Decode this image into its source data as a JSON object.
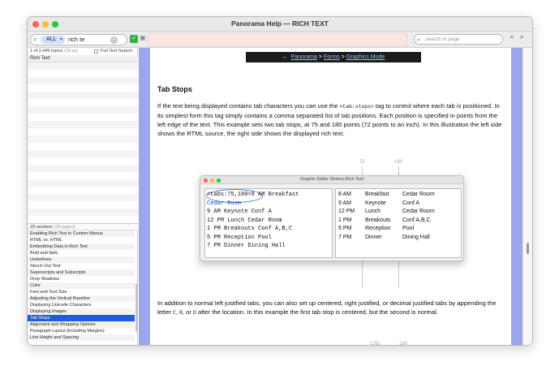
{
  "window": {
    "title": "Panorama Help — RICH TEXT"
  },
  "toolbar": {
    "search_scope": "ALL",
    "search_query": "rich te",
    "page_search_placeholder": "search in page",
    "prev": "<",
    "next": ">"
  },
  "sidebar": {
    "topics_count": "1 of 2,445 topics",
    "topics_pages": "(28 pp)",
    "full_text_label": "Full Text Search",
    "selected_topic": "Rich Text",
    "sections_count": "29 sections",
    "sections_pages": "(28 pages)",
    "sections": [
      "Enabling Rich Text in Custom Menus",
      "RTML vs. HTML",
      "Embedding Data in Rich Text",
      "Bold and Italic",
      "Underlines",
      "Struck Out Text",
      "Superscripts and Subscripts",
      "Drop Shadows",
      "Color",
      "Font and Text Size",
      "Adjusting the Vertical Baseline",
      "Displaying Unicode Characters",
      "Displaying Images",
      "Tab Stops",
      "Alignment and Wrapping Options",
      "Paragraph Layout (including Margins)",
      "Line Height and Spacing"
    ],
    "selected_section": "Tab Stops"
  },
  "breadcrumb": {
    "arrow": "←",
    "items": [
      "Panorama",
      "Forms",
      "Graphics Mode"
    ],
    "sep": ">"
  },
  "article": {
    "heading": "Tab Stops",
    "p1_a": "If the text being displayed contains tab characters you can use the ",
    "p1_code": "<tab:stops>",
    "p1_b": " tag to control where each tab is positioned. In its simplest form this tag simply contains a comma separated list of tab positions. Each position is specified in points from the left edge of the text. This example sets two tab stops, at 75 and 180 points (72 points to an inch). In this illustration the left side shows the RTML source, the right side shows the displayed rich text.",
    "p2_a": "In addition to normal left justified tabs, you can also set up centered, right justified, or decimal justified tabs by appending the letter ",
    "p2_c": "C",
    "p2_r": "R",
    "p2_d": "D",
    "p2_sep1": ", ",
    "p2_sep2": ", or ",
    "p2_b": " after the location. In this example the first tab stop is centered, but the second is normal."
  },
  "figure1": {
    "title": "Graphic Editor Demos:Rich Text",
    "ruler_a": "75",
    "ruler_b": "180",
    "source_lines": [
      "<tabs:75,180>8 AM Breakfast",
      "Cedar Room",
      "9 AM Keynote Conf A",
      "12 PM Lunch Cedar Room",
      "1 PM Breakouts Conf A,B,C",
      "5 PM Reception Pool",
      "7 PM Dinner Dining Hall"
    ],
    "rendered_rows": [
      [
        "8 AM",
        "Breakfast",
        "Cedar Room"
      ],
      [
        "9 AM",
        "Keynote",
        "Conf A"
      ],
      [
        "12 PM",
        "Lunch",
        "Cedar Room"
      ],
      [
        "1 PM",
        "Breakouts",
        "Conf A,B,C"
      ],
      [
        "5 PM",
        "Reception",
        "Pool"
      ],
      [
        "7 PM",
        "Dinner",
        "Dining Hall"
      ]
    ]
  },
  "figure2": {
    "ruler_a": "125c",
    "ruler_b": "190"
  },
  "colors": {
    "gutter": "#9ca6ea",
    "selection": "#1e5ddb",
    "nav_bg": "#1c1c1c",
    "link": "#9ec5ff"
  }
}
